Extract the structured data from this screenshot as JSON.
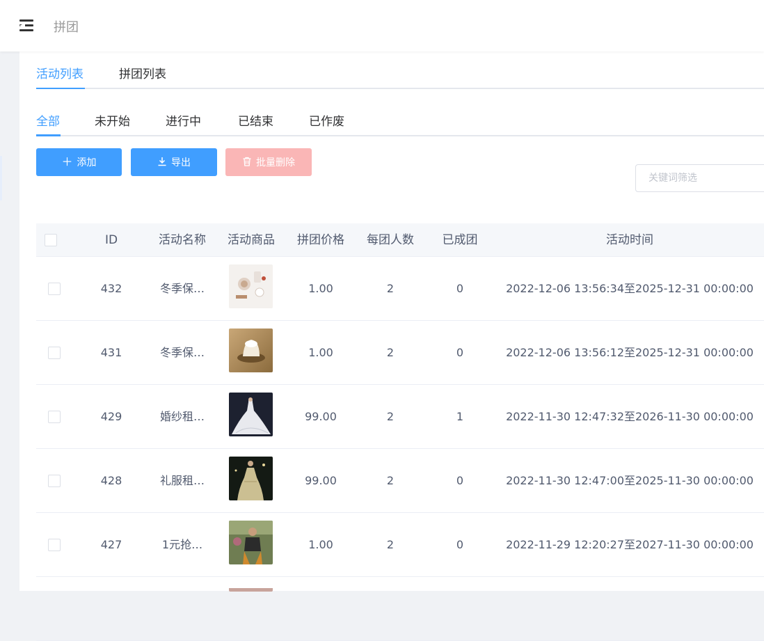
{
  "header": {
    "title": "拼团"
  },
  "tabs_main": [
    {
      "label": "活动列表"
    },
    {
      "label": "拼团列表"
    }
  ],
  "tabs_status": [
    {
      "label": "全部"
    },
    {
      "label": "未开始"
    },
    {
      "label": "进行中"
    },
    {
      "label": "已结束"
    },
    {
      "label": "已作废"
    }
  ],
  "toolbar": {
    "add_label": "添加",
    "export_label": "导出",
    "batch_delete_label": "批量删除"
  },
  "search": {
    "placeholder": "关键词筛选",
    "value": ""
  },
  "table": {
    "columns": {
      "id": "ID",
      "name": "活动名称",
      "goods": "活动商品",
      "price": "拼团价格",
      "size": "每团人数",
      "done": "已成团",
      "time": "活动时间"
    },
    "rows": [
      {
        "id": "432",
        "name": "冬季保…",
        "price": "1.00",
        "size": "2",
        "done": "0",
        "time": "2022-12-06 13:56:34至2025-12-31 00:00:00"
      },
      {
        "id": "431",
        "name": "冬季保…",
        "price": "1.00",
        "size": "2",
        "done": "0",
        "time": "2022-12-06 13:56:12至2025-12-31 00:00:00"
      },
      {
        "id": "429",
        "name": "婚纱租…",
        "price": "99.00",
        "size": "2",
        "done": "1",
        "time": "2022-11-30 12:47:32至2026-11-30 00:00:00"
      },
      {
        "id": "428",
        "name": "礼服租…",
        "price": "99.00",
        "size": "2",
        "done": "0",
        "time": "2022-11-30 12:47:00至2025-11-30 00:00:00"
      },
      {
        "id": "427",
        "name": "1元抢…",
        "price": "1.00",
        "size": "2",
        "done": "0",
        "time": "2022-11-29 12:20:27至2027-11-30 00:00:00"
      }
    ]
  },
  "colors": {
    "primary": "#409eff",
    "danger_disabled": "#fab6b6",
    "text": "#303133",
    "muted": "#515a6e"
  }
}
